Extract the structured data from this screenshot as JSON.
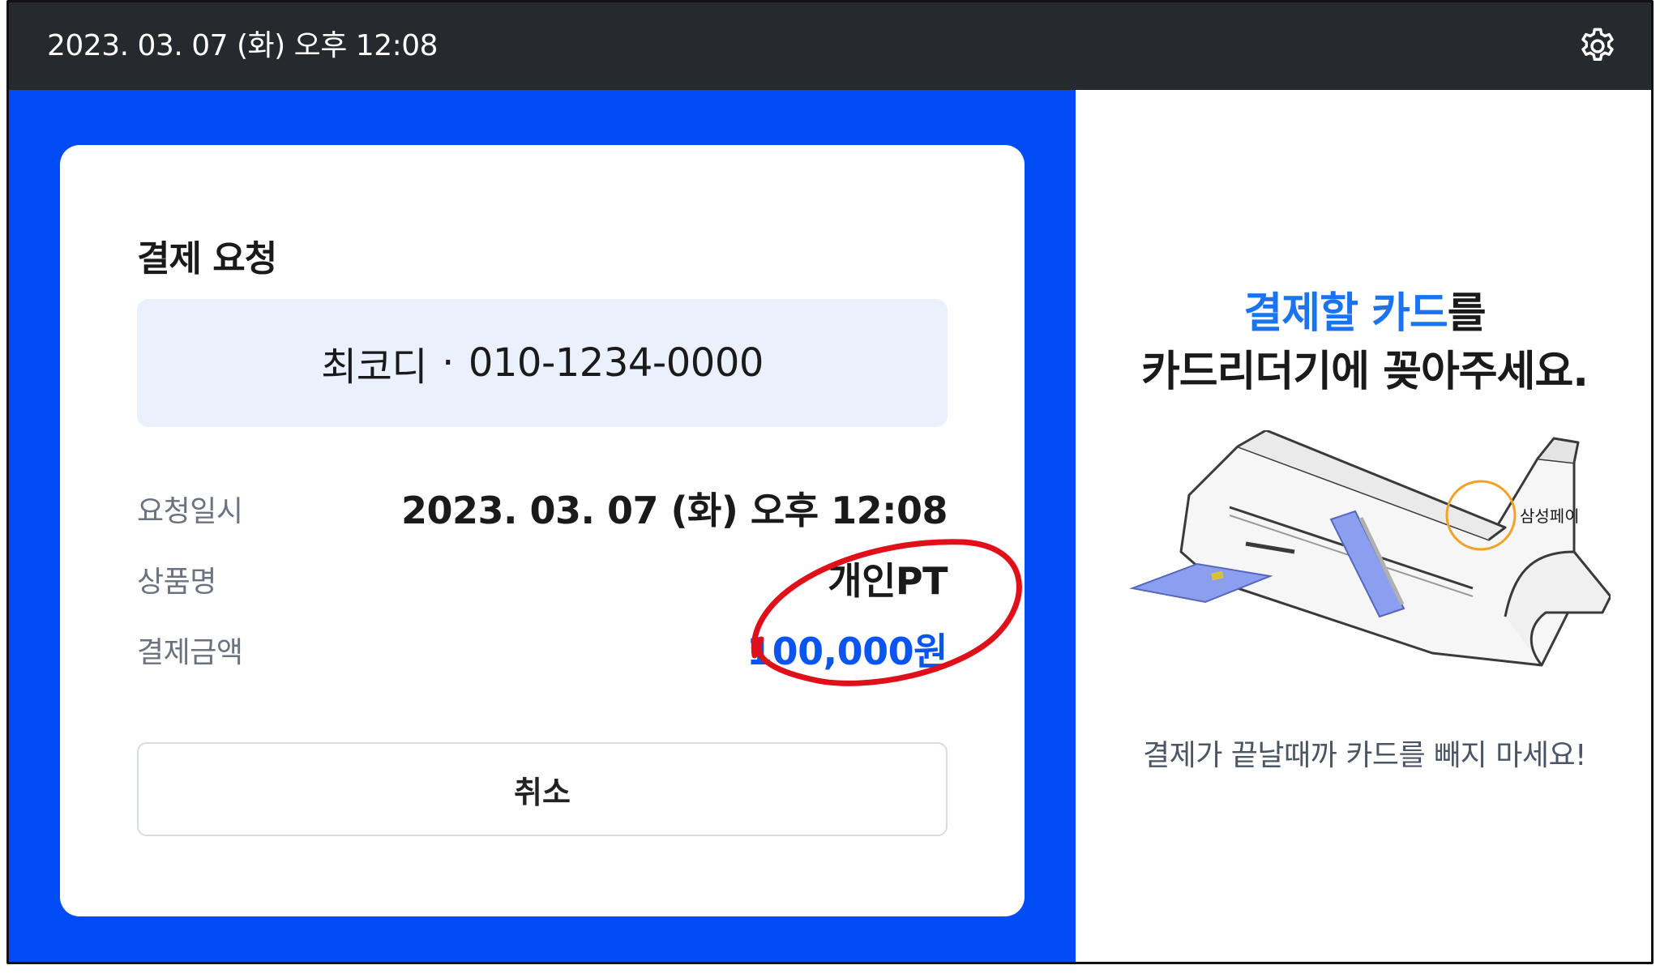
{
  "topbar": {
    "datetime": "2023. 03. 07 (화) 오후 12:08",
    "settings_icon": "gear-icon"
  },
  "payment_card": {
    "title": "결제 요청",
    "customer_name": "최코디",
    "separator": "·",
    "customer_phone": "010-1234-0000",
    "rows": [
      {
        "label": "요청일시",
        "value": "2023. 03. 07 (화) 오후 12:08"
      },
      {
        "label": "상품명",
        "value": "개인PT"
      },
      {
        "label": "결제금액",
        "value": "100,000원"
      }
    ],
    "cancel_label": "취소"
  },
  "instructions": {
    "line1_highlight": "결제할 카드",
    "line1_rest": "를",
    "line2": "카드리더기에 꽂아주세요.",
    "device_label": "삼성페이",
    "warning": "결제가 끝날때까 카드를 빼지 마세요!"
  },
  "colors": {
    "topbar_bg": "#262a2f",
    "brand_blue": "#004bf3",
    "highlight_blue": "#1a73f0",
    "amount_blue": "#0a55f0",
    "annotation_red": "#e0101a"
  }
}
